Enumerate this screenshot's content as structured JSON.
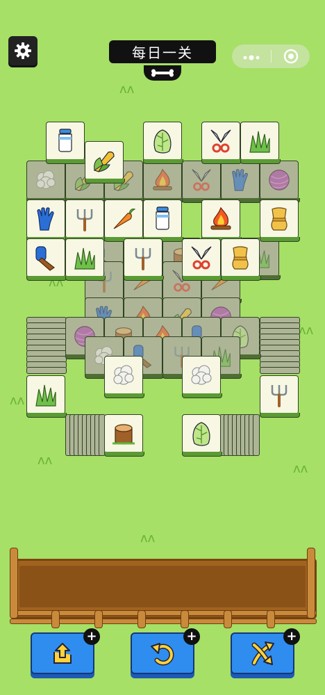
{
  "header": {
    "title": "每日一关"
  },
  "icons": {
    "settings": "gear-icon",
    "title_tab": "bone-icon",
    "capsule_more": "more-dots-icon",
    "capsule_close": "close-circle-icon"
  },
  "colors": {
    "background": "#a6e066",
    "tile_face": "#f7f7e3",
    "tile_covered": "#aeb597",
    "tile_edge": "#5b9b33",
    "tray_wood": "#a2631f",
    "button_blue": "#2f8df0"
  },
  "board": {
    "top_layer_tiles": [
      {
        "icon": "milk-bottle"
      },
      {
        "icon": "corn"
      },
      {
        "icon": "cabbage"
      },
      {
        "icon": "shears"
      },
      {
        "icon": "grass"
      },
      {
        "icon": "glove"
      },
      {
        "icon": "hand-fork"
      },
      {
        "icon": "carrot"
      },
      {
        "icon": "milk-bottle"
      },
      {
        "icon": "campfire"
      },
      {
        "icon": "wheat"
      },
      {
        "icon": "brush"
      },
      {
        "icon": "grass"
      },
      {
        "icon": "hand-fork"
      },
      {
        "icon": "shears"
      },
      {
        "icon": "wheat"
      },
      {
        "icon": "wool"
      },
      {
        "icon": "wool"
      },
      {
        "icon": "grass"
      },
      {
        "icon": "hand-fork"
      },
      {
        "icon": "stump"
      },
      {
        "icon": "cabbage"
      }
    ]
  },
  "tray": {
    "slots_filled": 0
  },
  "tools": [
    {
      "name": "move-out",
      "icon": "move-out-icon",
      "plus": "+"
    },
    {
      "name": "undo",
      "icon": "undo-icon",
      "plus": "+"
    },
    {
      "name": "shuffle",
      "icon": "shuffle-icon",
      "plus": "+"
    }
  ]
}
